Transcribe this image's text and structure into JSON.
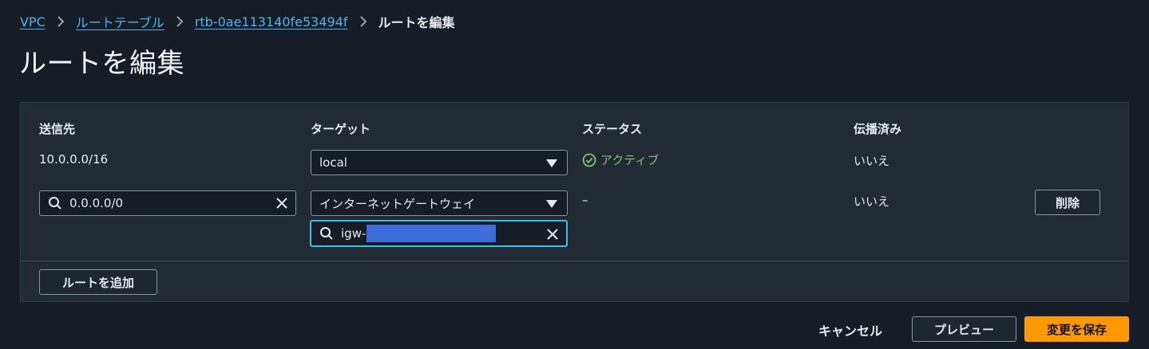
{
  "breadcrumb": {
    "items": [
      "VPC",
      "ルートテーブル",
      "rtb-0ae113140fe53494f"
    ],
    "current": "ルートを編集"
  },
  "page_title": "ルートを編集",
  "table": {
    "headers": {
      "destination": "送信先",
      "target": "ターゲット",
      "status": "ステータス",
      "propagated": "伝播済み"
    },
    "rows": [
      {
        "destination": "10.0.0.0/16",
        "target": "local",
        "status": "アクティブ",
        "propagated": "いいえ"
      },
      {
        "destination": "0.0.0.0/0",
        "target": "インターネットゲートウェイ",
        "target_search": "igw-",
        "status": "–",
        "propagated": "いいえ",
        "remove_label": "削除"
      }
    ]
  },
  "add_route_label": "ルートを追加",
  "footer": {
    "cancel": "キャンセル",
    "preview": "プレビュー",
    "save": "変更を保存"
  },
  "colors": {
    "accent": "#ff9900",
    "link": "#4fb3f2",
    "success": "#7bc96f",
    "focus": "#3bbfe9"
  },
  "icons": [
    "chevron-right-icon",
    "search-icon",
    "clear-icon",
    "caret-down-icon",
    "check-circle-icon"
  ]
}
